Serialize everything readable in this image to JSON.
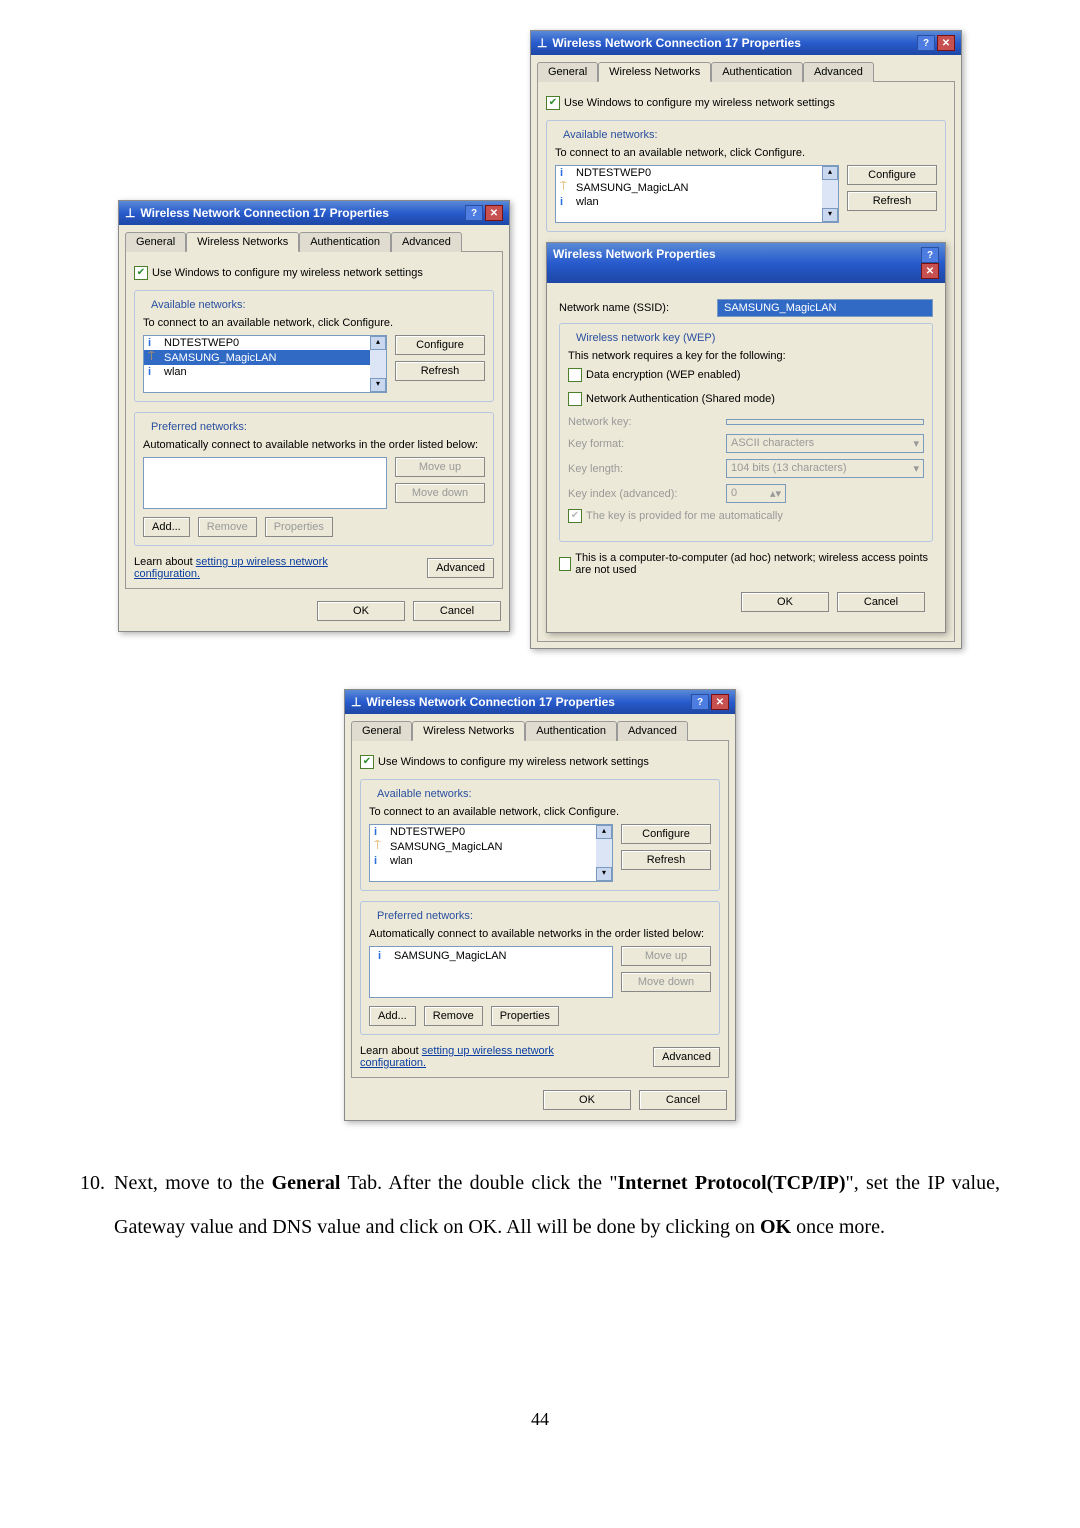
{
  "doc": {
    "list_marker": "10.",
    "paragraph_prefix": "Next, move to the ",
    "bold1": "General",
    "paragraph_mid1": " Tab. After the double click the \"",
    "bold2": "Internet Protocol(TCP/IP)",
    "paragraph_mid2": "\", set the IP value, Gateway value and DNS value and click on OK. All will be done by clicking  on ",
    "bold3": "OK",
    "paragraph_end": " once more.",
    "page_num": "44"
  },
  "win_title": "Wireless Network Connection 17 Properties",
  "tabs": {
    "general": "General",
    "wireless": "Wireless Networks",
    "auth": "Authentication",
    "adv": "Advanced"
  },
  "use_windows_label": "Use Windows to configure my wireless network settings",
  "available": {
    "legend": "Available networks:",
    "hint": "To connect to an available network, click Configure.",
    "items": [
      "NDTESTWEP0",
      "SAMSUNG_MagicLAN",
      "wlan"
    ],
    "configure": "Configure",
    "refresh": "Refresh"
  },
  "preferred": {
    "legend": "Preferred networks:",
    "hint": "Automatically connect to available networks in the order listed below:",
    "moveup": "Move up",
    "movedown": "Move down",
    "add": "Add...",
    "remove": "Remove",
    "properties": "Properties",
    "item": "SAMSUNG_MagicLAN"
  },
  "learn_about": "Learn about ",
  "learn_link": "setting up wireless network",
  "learn_after": "configuration.",
  "advanced_btn": "Advanced",
  "ok": "OK",
  "cancel": "Cancel",
  "wprops": {
    "title": "Wireless Network Properties",
    "ssid_label": "Network name (SSID):",
    "ssid_value": "SAMSUNG_MagicLAN",
    "wep_legend": "Wireless network key (WEP)",
    "wep_hint": "This network requires a key for the following:",
    "data_enc": "Data encryption (WEP enabled)",
    "net_auth": "Network Authentication (Shared mode)",
    "netkey": "Network key:",
    "keyformat": "Key format:",
    "keyformat_val": "ASCII characters",
    "keylen": "Key length:",
    "keylen_val": "104 bits (13 characters)",
    "keyidx": "Key index (advanced):",
    "keyidx_val": "0",
    "auto": "The key is provided for me automatically",
    "adhoc": "This is a computer-to-computer (ad hoc) network; wireless access points are not used"
  }
}
